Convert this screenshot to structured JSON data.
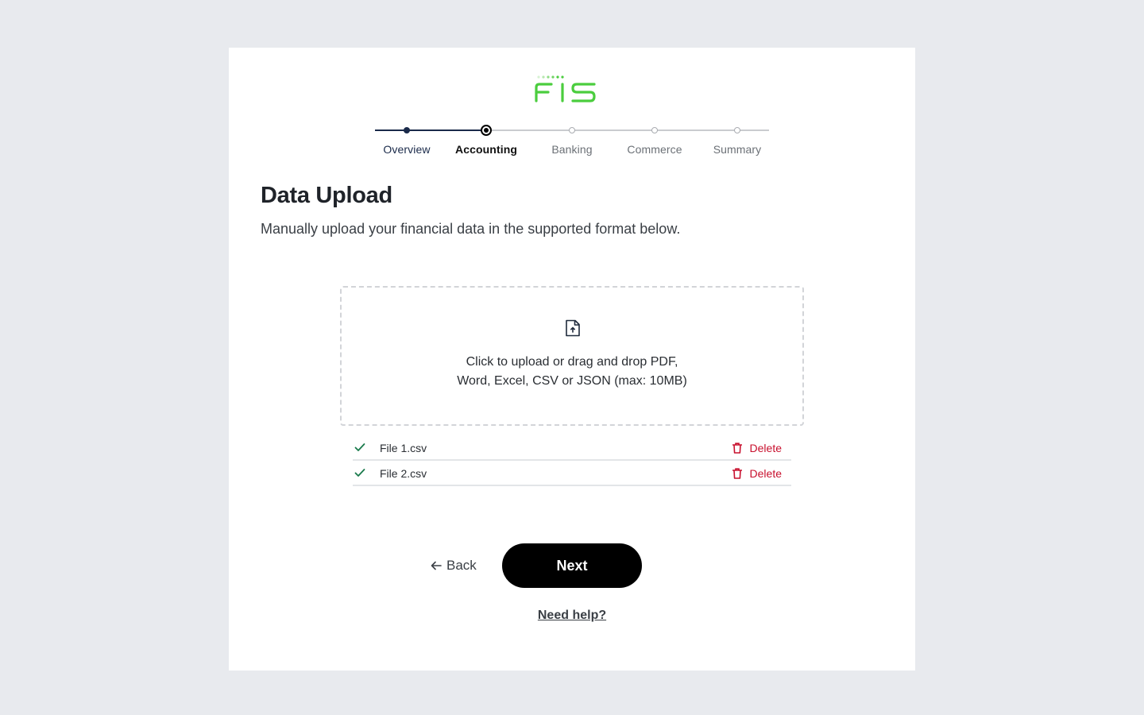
{
  "brand": {
    "logo_text": "FIS",
    "color": "#4bcd3e"
  },
  "stepper": {
    "steps": [
      {
        "label": "Overview",
        "state": "completed"
      },
      {
        "label": "Accounting",
        "state": "current"
      },
      {
        "label": "Banking",
        "state": "upcoming"
      },
      {
        "label": "Commerce",
        "state": "upcoming"
      },
      {
        "label": "Summary",
        "state": "upcoming"
      }
    ],
    "colors": {
      "completed": "#1a2a4a",
      "current": "#000000",
      "upcoming": "#b5b8bd"
    }
  },
  "page": {
    "title": "Data Upload",
    "subtitle": "Manually upload your financial data in the supported format below."
  },
  "dropzone": {
    "icon": "file-upload-icon",
    "line1": "Click to upload or drag and drop PDF,",
    "line2": "Word, Excel, CSV or JSON (max: 10MB)"
  },
  "files": [
    {
      "name": "File 1.csv",
      "status": "uploaded",
      "action": "Delete"
    },
    {
      "name": "File 2.csv",
      "status": "uploaded",
      "action": "Delete"
    }
  ],
  "actions": {
    "back_label": "Back",
    "next_label": "Next",
    "help_label": "Need help?"
  },
  "colors": {
    "background": "#e8eaee",
    "card": "#ffffff",
    "danger": "#c8102e",
    "success": "#1a7a4c",
    "primary_button": "#000000"
  }
}
